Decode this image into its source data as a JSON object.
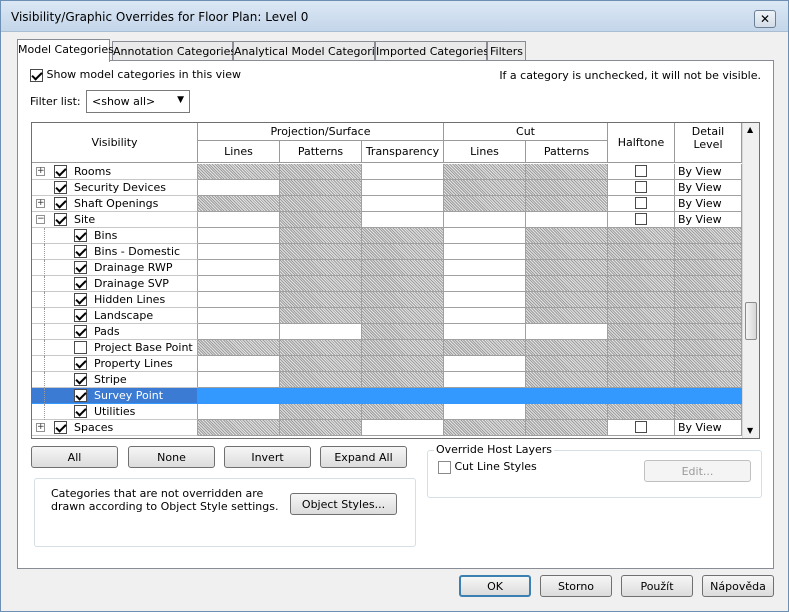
{
  "window": {
    "title": "Visibility/Graphic Overrides for Floor Plan: Level 0",
    "close_label": "✕"
  },
  "tabs": [
    {
      "label": "Model Categories",
      "active": true
    },
    {
      "label": "Annotation Categories",
      "active": false
    },
    {
      "label": "Analytical Model Categories",
      "active": false
    },
    {
      "label": "Imported Categories",
      "active": false
    },
    {
      "label": "Filters",
      "active": false
    }
  ],
  "options": {
    "show_model_label": "Show model categories in this view",
    "show_model_checked": true,
    "hint": "If a category is unchecked, it will not be visible.",
    "filter_label": "Filter list:",
    "filter_value": "<show all>"
  },
  "table": {
    "header": {
      "visibility": "Visibility",
      "projection_surface": "Projection/Surface",
      "cut": "Cut",
      "halftone": "Halftone",
      "detail_level": "Detail Level",
      "proj_lines": "Lines",
      "proj_patterns": "Patterns",
      "proj_transparency": "Transparency",
      "cut_lines": "Lines",
      "cut_patterns": "Patterns"
    },
    "rows": [
      {
        "name": "Rooms",
        "level": 0,
        "expander": "+",
        "checked": true,
        "detail": "By View",
        "selected": false
      },
      {
        "name": "Security Devices",
        "level": 0,
        "expander": "",
        "checked": true,
        "detail": "By View",
        "selected": false
      },
      {
        "name": "Shaft Openings",
        "level": 0,
        "expander": "+",
        "checked": true,
        "detail": "By View",
        "selected": false
      },
      {
        "name": "Site",
        "level": 0,
        "expander": "−",
        "checked": true,
        "detail": "By View",
        "selected": false
      },
      {
        "name": "Bins",
        "level": 1,
        "expander": "",
        "checked": true,
        "detail": "",
        "selected": false
      },
      {
        "name": "Bins - Domestic",
        "level": 1,
        "expander": "",
        "checked": true,
        "detail": "",
        "selected": false
      },
      {
        "name": "Drainage RWP",
        "level": 1,
        "expander": "",
        "checked": true,
        "detail": "",
        "selected": false
      },
      {
        "name": "Drainage SVP",
        "level": 1,
        "expander": "",
        "checked": true,
        "detail": "",
        "selected": false
      },
      {
        "name": "Hidden Lines",
        "level": 1,
        "expander": "",
        "checked": true,
        "detail": "",
        "selected": false
      },
      {
        "name": "Landscape",
        "level": 1,
        "expander": "",
        "checked": true,
        "detail": "",
        "selected": false
      },
      {
        "name": "Pads",
        "level": 1,
        "expander": "",
        "checked": true,
        "detail": "",
        "selected": false
      },
      {
        "name": "Project Base Point",
        "level": 1,
        "expander": "",
        "checked": false,
        "detail": "",
        "selected": false
      },
      {
        "name": "Property Lines",
        "level": 1,
        "expander": "",
        "checked": true,
        "detail": "",
        "selected": false
      },
      {
        "name": "Stripe",
        "level": 1,
        "expander": "",
        "checked": true,
        "detail": "",
        "selected": false
      },
      {
        "name": "Survey Point",
        "level": 1,
        "expander": "",
        "checked": true,
        "detail": "",
        "selected": true
      },
      {
        "name": "Utilities",
        "level": 1,
        "expander": "",
        "checked": true,
        "detail": "",
        "selected": false
      },
      {
        "name": "Spaces",
        "level": 0,
        "expander": "+",
        "checked": true,
        "detail": "By View",
        "selected": false
      }
    ]
  },
  "buttons": {
    "all": "All",
    "none": "None",
    "invert": "Invert",
    "expand_all": "Expand All",
    "object_styles": "Object Styles...",
    "edit": "Edit...",
    "ok": "OK",
    "cancel": "Storno",
    "apply": "Použít",
    "help": "Nápověda"
  },
  "info_text": "Categories that are not overridden are drawn according to Object Style settings.",
  "override_host": {
    "title": "Override Host Layers",
    "cut_line_styles": "Cut Line Styles",
    "checked": false
  }
}
